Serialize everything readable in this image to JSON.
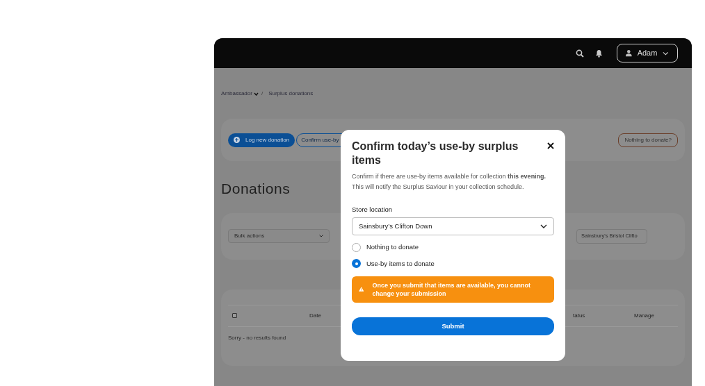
{
  "header": {
    "user": "Adam"
  },
  "breadcrumb": [
    "Ambassador",
    "/",
    "Surplus donations"
  ],
  "actions": {
    "log_button": "Log new donation",
    "confirm_button": "Confirm use-by",
    "nothing_button": "Nothing to donate?"
  },
  "page_title": "Donations",
  "filters": {
    "bulk_actions": "Bulk actions",
    "store": "Sainsbury's Bristol Clifto"
  },
  "table": {
    "select_all_checked": false,
    "columns": [
      "Date",
      "tatus",
      "Manage"
    ],
    "empty_message": "Sorry - no results found"
  },
  "modal": {
    "title": "Confirm today’s use-by surplus items",
    "description": "Confirm if there are use-by items available for collection **this evening.** This will notify the Surplus Saviour in your collection schedule.",
    "field_label": "Store location",
    "store_value": "Sainsbury’s Clifton Down",
    "options": [
      {
        "label": "Nothing to donate",
        "selected": false
      },
      {
        "label": "Use-by items to donate",
        "selected": true
      }
    ],
    "warning": "Once you submit that items are available, you cannot change your submission",
    "submit": "Submit"
  }
}
